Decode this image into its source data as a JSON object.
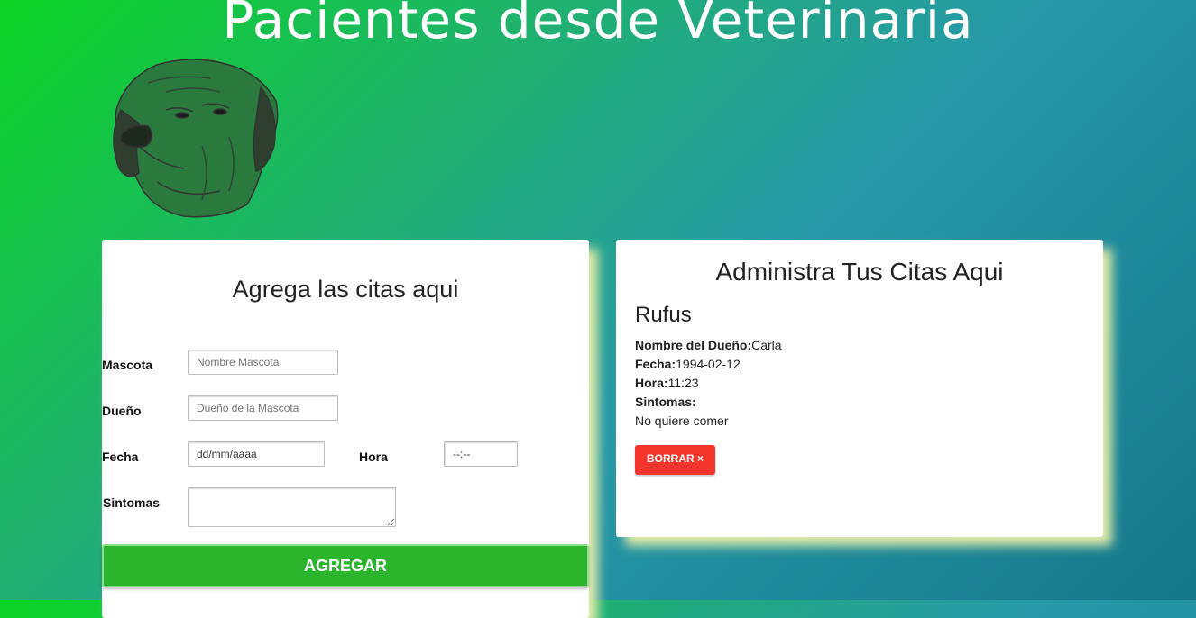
{
  "header": {
    "title": "Pacientes desde Veterinaria",
    "logo": "dog-head-icon"
  },
  "form": {
    "title": "Agrega las citas aqui",
    "pet": {
      "label": "Mascota",
      "placeholder": "Nombre Mascota"
    },
    "owner": {
      "label": "Dueño",
      "placeholder": "Dueño de la Mascota"
    },
    "date": {
      "label": "Fecha",
      "value": "dd/mm/aaaa"
    },
    "time": {
      "label": "Hora",
      "value": "--:--"
    },
    "symptoms": {
      "label": "Sintomas",
      "value": ""
    },
    "submit_label": "AGREGAR"
  },
  "appointments": {
    "title": "Administra Tus Citas Aqui",
    "items": [
      {
        "pet": "Rufus",
        "owner_label": "Nombre del Dueño:",
        "owner": "Carla",
        "date_label": "Fecha:",
        "date": "1994-02-12",
        "time_label": "Hora:",
        "time": "11:23",
        "symptoms_label": "Sintomas:",
        "symptoms": "No quiere comer",
        "delete_label": "BORRAR ×"
      }
    ]
  },
  "colors": {
    "accent_green": "#2bb52d",
    "delete_red": "#f3352b",
    "shadow_yellow": "#ecf0aa"
  }
}
